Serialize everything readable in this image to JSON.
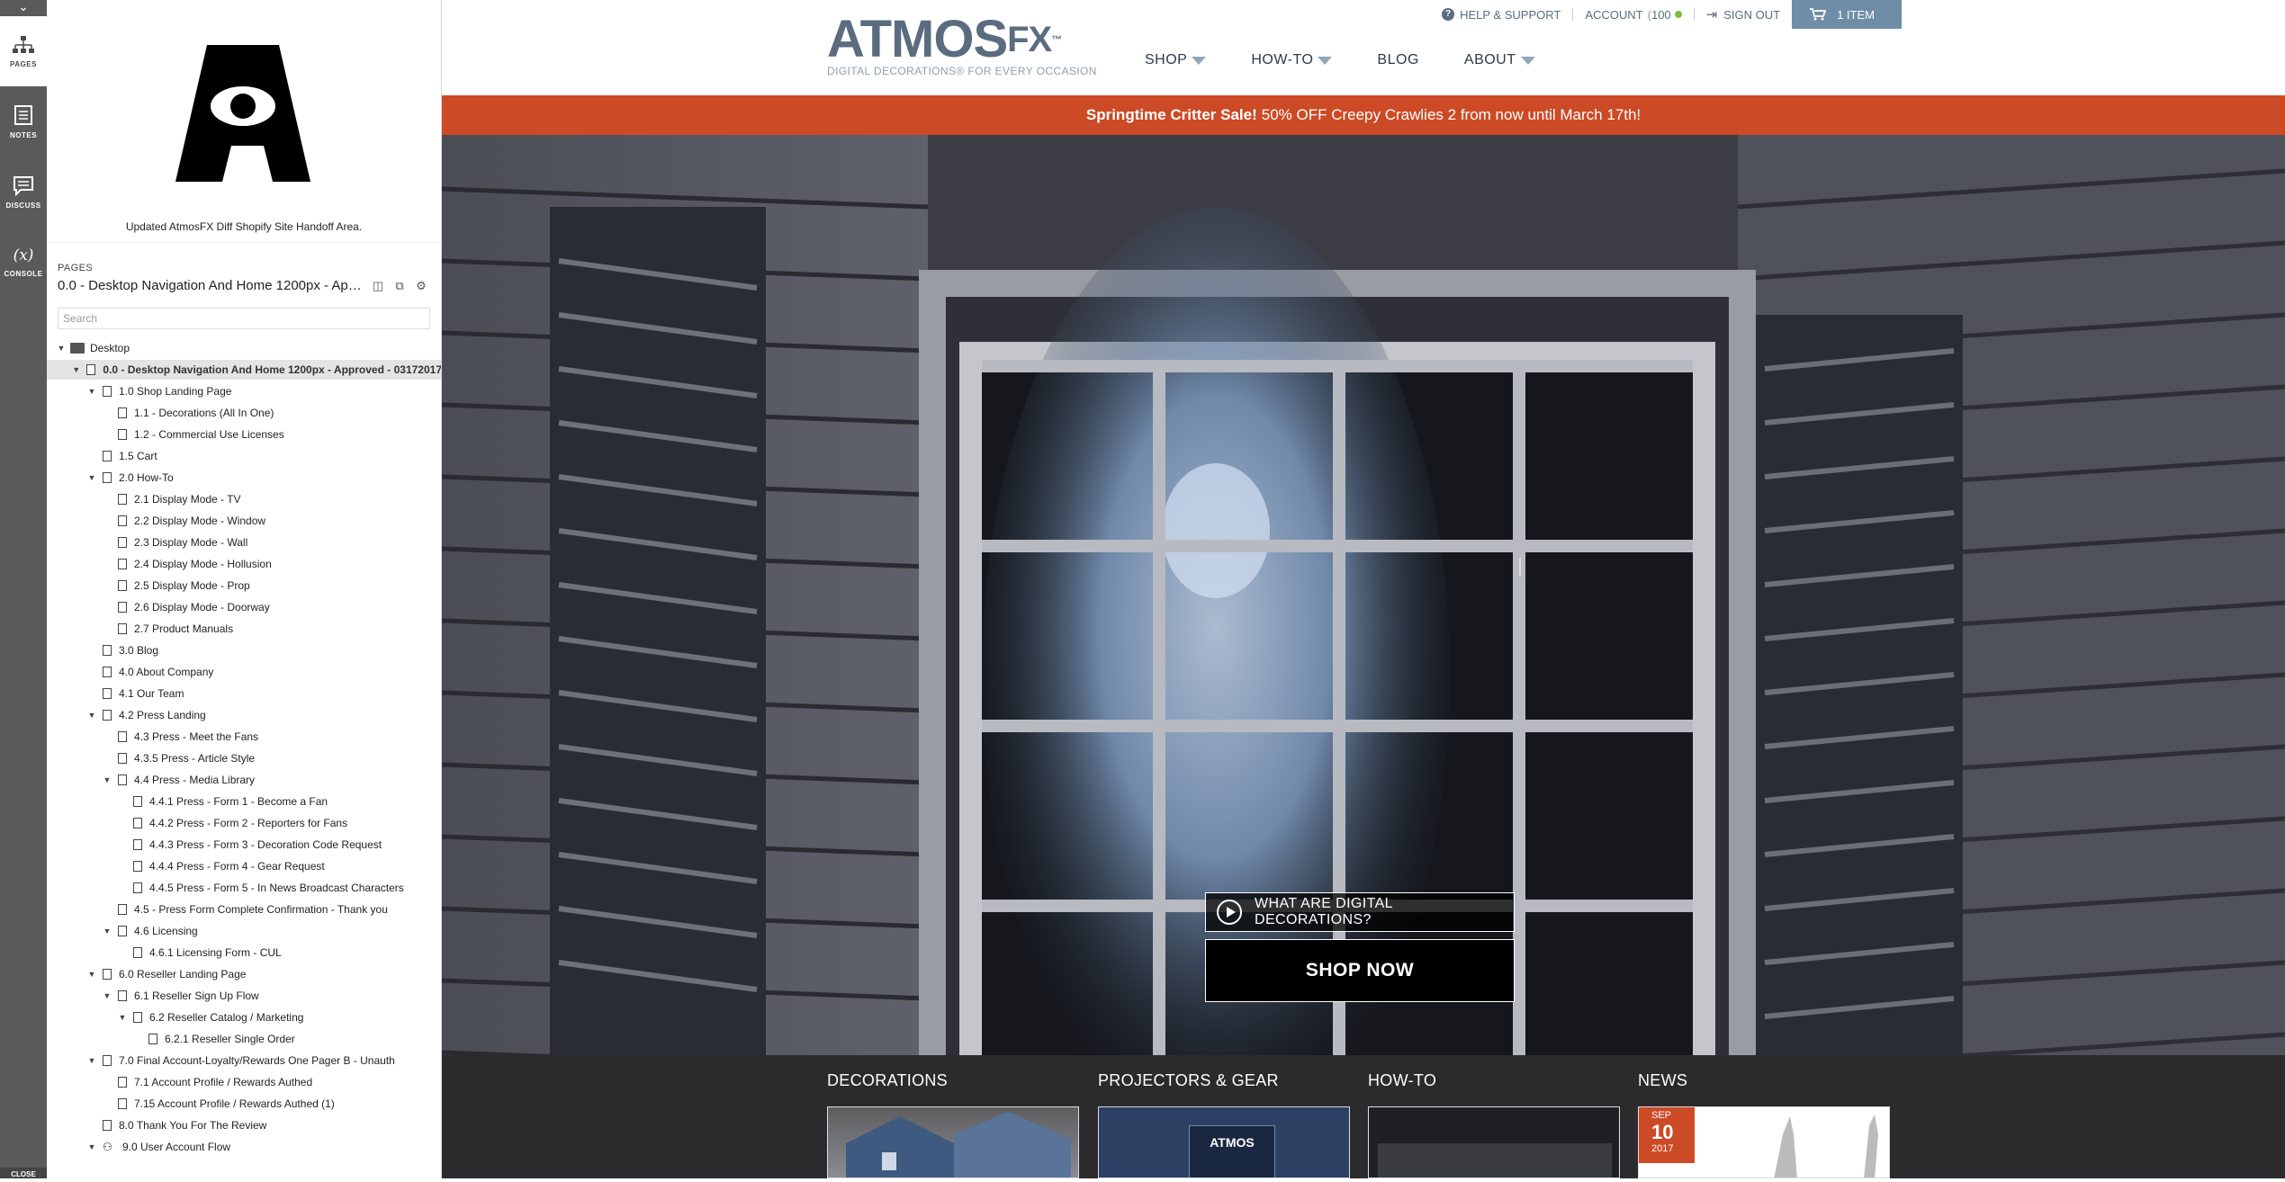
{
  "rail": {
    "tools": [
      {
        "label": "PAGES",
        "icon": "sitemap-icon"
      },
      {
        "label": "NOTES",
        "icon": "notes-icon"
      },
      {
        "label": "DISCUSS",
        "icon": "discuss-icon"
      },
      {
        "label": "CONSOLE",
        "icon": "console-icon"
      }
    ],
    "close_label": "CLOSE"
  },
  "panel": {
    "caption": "Updated AtmosFX Diff Shopify Site Handoff Area.",
    "pages_label": "PAGES",
    "current_page": "0.0 - Desktop Navigation And Home 1200px - Approved - 03172017",
    "search_placeholder": "Search",
    "tree": [
      {
        "label": "Desktop",
        "level": 0,
        "type": "folder",
        "open": true
      },
      {
        "label": "0.0 - Desktop Navigation And Home 1200px - Approved - 03172017",
        "level": 1,
        "type": "page",
        "open": true,
        "selected": true
      },
      {
        "label": "1.0 Shop Landing Page",
        "level": 2,
        "type": "page",
        "open": true
      },
      {
        "label": "1.1 - Decorations (All In One)",
        "level": 3,
        "type": "page"
      },
      {
        "label": "1.2 - Commercial Use Licenses",
        "level": 3,
        "type": "page"
      },
      {
        "label": "1.5 Cart",
        "level": 2,
        "type": "page"
      },
      {
        "label": "2.0 How-To",
        "level": 2,
        "type": "page",
        "open": true
      },
      {
        "label": "2.1 Display Mode - TV",
        "level": 3,
        "type": "page"
      },
      {
        "label": "2.2 Display Mode - Window",
        "level": 3,
        "type": "page"
      },
      {
        "label": "2.3 Display Mode - Wall",
        "level": 3,
        "type": "page"
      },
      {
        "label": "2.4 Display Mode - Hollusion",
        "level": 3,
        "type": "page"
      },
      {
        "label": "2.5 Display Mode - Prop",
        "level": 3,
        "type": "page"
      },
      {
        "label": "2.6 Display Mode - Doorway",
        "level": 3,
        "type": "page"
      },
      {
        "label": "2.7 Product Manuals",
        "level": 3,
        "type": "page"
      },
      {
        "label": "3.0 Blog",
        "level": 2,
        "type": "page"
      },
      {
        "label": "4.0 About Company",
        "level": 2,
        "type": "page"
      },
      {
        "label": "4.1 Our Team",
        "level": 2,
        "type": "page"
      },
      {
        "label": "4.2 Press Landing",
        "level": 2,
        "type": "page",
        "open": true
      },
      {
        "label": "4.3 Press - Meet the Fans",
        "level": 3,
        "type": "page"
      },
      {
        "label": "4.3.5 Press - Article Style",
        "level": 3,
        "type": "page"
      },
      {
        "label": "4.4 Press - Media Library",
        "level": 3,
        "type": "page",
        "open": true
      },
      {
        "label": "4.4.1 Press - Form 1 - Become a Fan",
        "level": 4,
        "type": "page"
      },
      {
        "label": "4.4.2 Press - Form 2 - Reporters for Fans",
        "level": 4,
        "type": "page"
      },
      {
        "label": "4.4.3 Press - Form 3 - Decoration Code Request",
        "level": 4,
        "type": "page"
      },
      {
        "label": "4.4.4 Press - Form 4 - Gear Request",
        "level": 4,
        "type": "page"
      },
      {
        "label": "4.4.5 Press - Form 5 - In News Broadcast Characters",
        "level": 4,
        "type": "page"
      },
      {
        "label": "4.5 - Press Form Complete Confirmation - Thank you",
        "level": 3,
        "type": "page"
      },
      {
        "label": "4.6 Licensing",
        "level": 3,
        "type": "page",
        "open": true
      },
      {
        "label": "4.6.1 Licensing Form - CUL",
        "level": 4,
        "type": "page"
      },
      {
        "label": "6.0 Reseller Landing Page",
        "level": 2,
        "type": "page",
        "open": true
      },
      {
        "label": "6.1 Reseller Sign Up Flow",
        "level": 3,
        "type": "page",
        "open": true
      },
      {
        "label": "6.2 Reseller Catalog / Marketing",
        "level": 4,
        "type": "page",
        "open": true
      },
      {
        "label": "6.2.1 Reseller Single Order",
        "level": 5,
        "type": "page"
      },
      {
        "label": "7.0 Final Account-Loyalty/Rewards One Pager B - Unauth",
        "level": 2,
        "type": "page",
        "open": true
      },
      {
        "label": "7.1 Account Profile / Rewards Authed",
        "level": 3,
        "type": "page"
      },
      {
        "label": "7.15 Account Profile / Rewards Authed (1)",
        "level": 3,
        "type": "page"
      },
      {
        "label": "8.0 Thank You For The Review",
        "level": 2,
        "type": "page"
      },
      {
        "label": "9.0 User Account Flow",
        "level": 2,
        "type": "flow",
        "open": true
      }
    ]
  },
  "site": {
    "brand": {
      "word": "ATMOS",
      "fx": "FX",
      "tm": "™",
      "tagline": "DIGITAL DECORATIONS® FOR EVERY OCCASION"
    },
    "utility": {
      "help": "HELP & SUPPORT",
      "account": "ACCOUNT",
      "points": "100",
      "signout": "SIGN OUT",
      "cart": "1 ITEM"
    },
    "nav": [
      {
        "label": "SHOP",
        "caret": true
      },
      {
        "label": "HOW-TO",
        "caret": true
      },
      {
        "label": "BLOG",
        "caret": false
      },
      {
        "label": "ABOUT",
        "caret": true
      }
    ],
    "promo": {
      "bold": "Springtime Critter Sale!",
      "rest": "50% OFF Creepy Crawlies 2 from now until March 17th!"
    },
    "cta": {
      "what": "WHAT ARE DIGITAL DECORATIONS?",
      "shop": "SHOP NOW"
    },
    "categories": [
      "DECORATIONS",
      "PROJECTORS & GEAR",
      "HOW-TO",
      "NEWS"
    ],
    "news_date": {
      "month": "SEP",
      "day": "10",
      "year": "2017"
    },
    "tile_product_label": "ATMOS",
    "colors": {
      "promo": "#cc4a26",
      "brand": "#5b6c80",
      "cart": "#6f8da6"
    }
  }
}
